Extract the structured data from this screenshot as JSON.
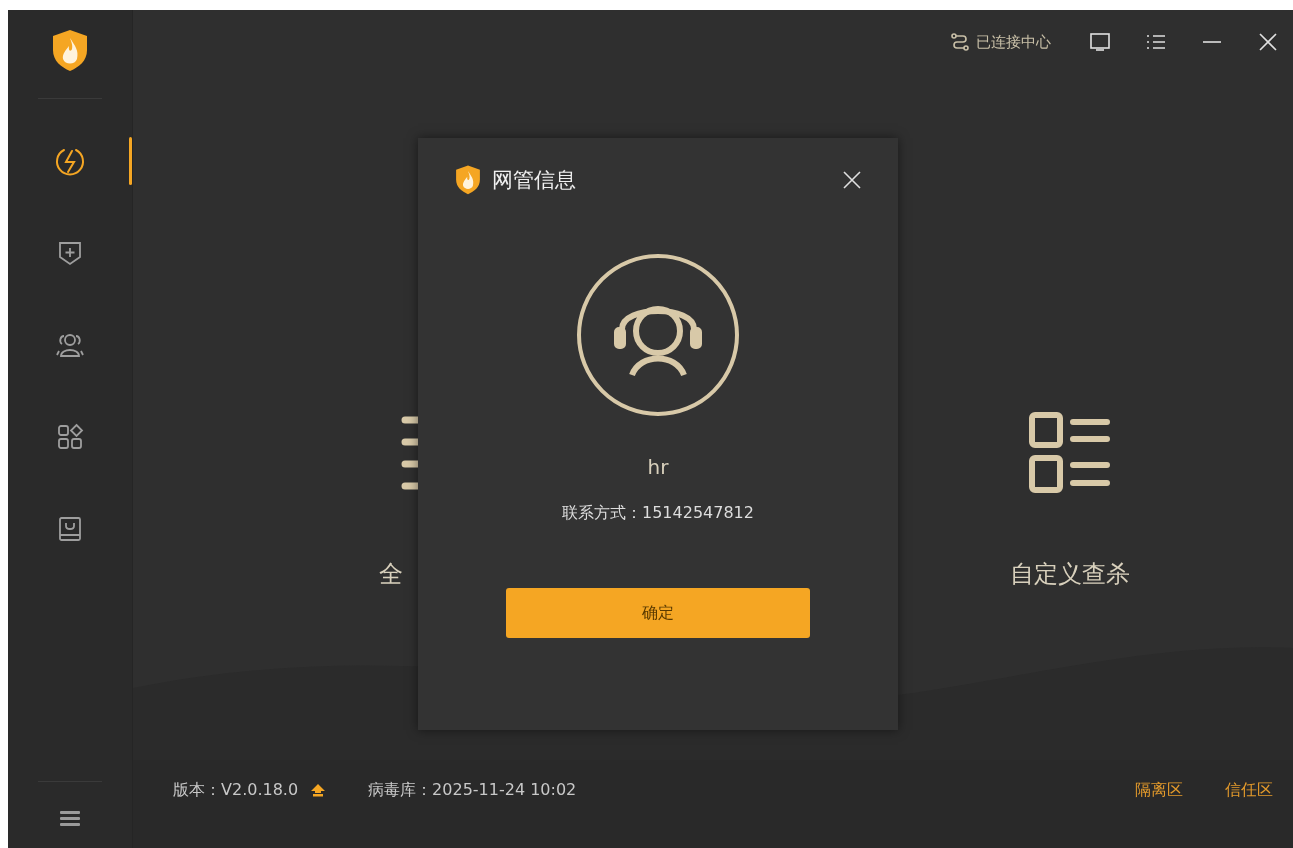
{
  "top_bar": {
    "connection_status": "已连接中心"
  },
  "sidebar": {
    "items": [
      {
        "kind": "scan",
        "selected": true
      },
      {
        "kind": "protect",
        "selected": false
      },
      {
        "kind": "users",
        "selected": false
      },
      {
        "kind": "apps",
        "selected": false
      },
      {
        "kind": "box",
        "selected": false
      }
    ]
  },
  "main": {
    "cards": [
      {
        "kind": "full",
        "label": "全"
      },
      {
        "kind": "custom",
        "label": "自定义查杀"
      }
    ]
  },
  "footer": {
    "version": "版本：V2.0.18.0",
    "virus_db": "病毒库：2025-11-24 10:02",
    "links": [
      "隔离区",
      "信任区"
    ]
  },
  "dialog": {
    "title": "网管信息",
    "name": "hr",
    "contact": "联系方式：15142547812",
    "button": "确定"
  }
}
